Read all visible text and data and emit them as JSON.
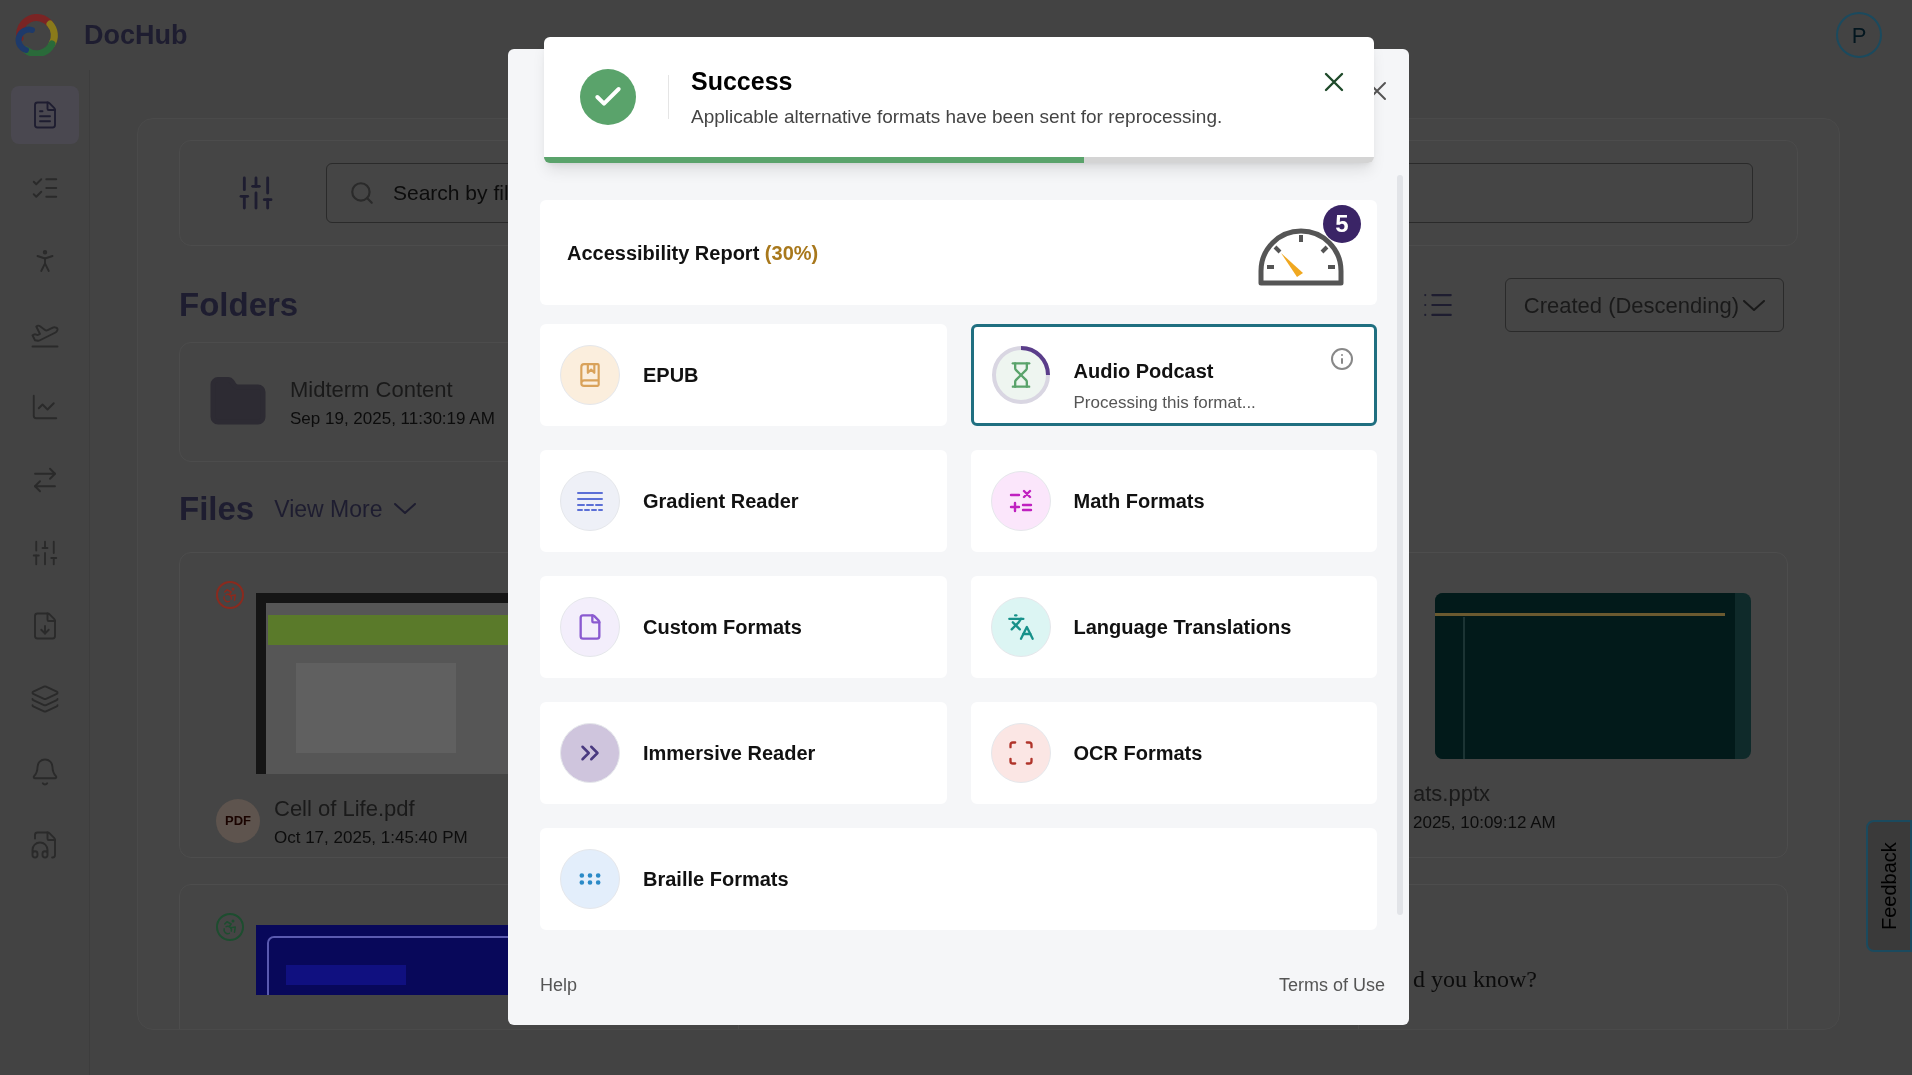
{
  "header": {
    "brand": "DocHub",
    "avatar": "P"
  },
  "sidebar": {
    "items": [
      {
        "selected": true
      },
      {
        "selected": false
      },
      {
        "selected": false
      },
      {
        "selected": false
      },
      {
        "selected": false
      },
      {
        "selected": false
      },
      {
        "selected": false
      },
      {
        "selected": false
      },
      {
        "selected": false
      },
      {
        "selected": false
      },
      {
        "selected": false
      }
    ]
  },
  "toolbar": {
    "search": {
      "placeholder": "Search by fil"
    }
  },
  "folders": {
    "heading": "Folders",
    "items": [
      {
        "name": "Midterm Content",
        "date": "Sep 19, 2025, 11:30:19 AM"
      }
    ]
  },
  "sort": {
    "value": "Created (Descending)"
  },
  "files": {
    "heading": "Files",
    "view_more": "View More",
    "items": [
      {
        "name": "Cell of Life.pdf",
        "date": "Oct 17, 2025, 1:45:40 PM",
        "type": "PDF",
        "color": "#8a2a1e"
      },
      {
        "name": "ats.pptx",
        "date": "2025, 10:09:12 AM"
      },
      {
        "color": "#1d4d2f"
      },
      {
        "text": "d you know?"
      }
    ]
  },
  "feedback": {
    "label": "Feedback"
  },
  "dialog": {
    "toast": {
      "title": "Success",
      "message": "Applicable alternative formats have been sent for reprocessing.",
      "level": 0.65
    },
    "report": {
      "title": "Accessibility Report",
      "score": "(30%)",
      "count": "5"
    },
    "formats": [
      {
        "label": "EPUB",
        "selected": false
      },
      {
        "label": "Audio Podcast",
        "selected": true,
        "status": "Processing this format..."
      },
      {
        "label": "Gradient Reader",
        "selected": false
      },
      {
        "label": "Math Formats",
        "selected": false
      },
      {
        "label": "Custom Formats",
        "selected": false
      },
      {
        "label": "Language Translations",
        "selected": false
      },
      {
        "label": "Immersive Reader",
        "selected": false
      },
      {
        "label": "OCR Formats",
        "selected": false
      },
      {
        "label": "Braille Formats",
        "selected": false
      }
    ],
    "footer": {
      "help": "Help",
      "terms": "Terms of Use"
    }
  }
}
